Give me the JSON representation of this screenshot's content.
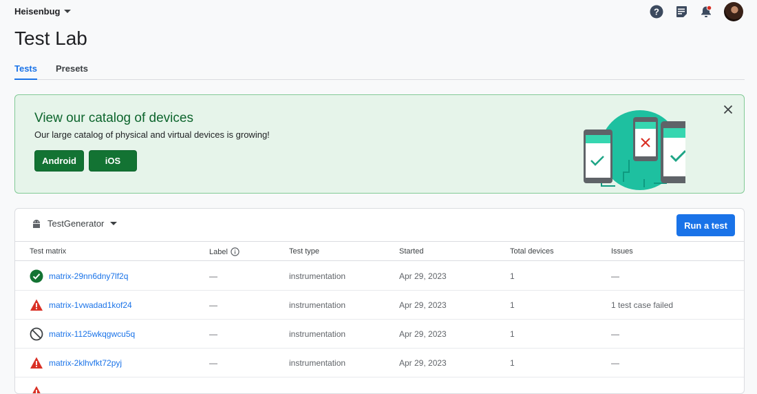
{
  "project": {
    "name": "Heisenbug"
  },
  "header_icons": [
    "help-icon",
    "notes-icon",
    "notifications-icon",
    "avatar"
  ],
  "page": {
    "title": "Test Lab"
  },
  "tabs": [
    {
      "label": "Tests",
      "active": true
    },
    {
      "label": "Presets",
      "active": false
    }
  ],
  "banner": {
    "title": "View our catalog of devices",
    "subtitle": "Our large catalog of physical and virtual devices is growing!",
    "android_label": "Android",
    "ios_label": "iOS"
  },
  "card": {
    "app_name": "TestGenerator",
    "run_label": "Run a test",
    "columns": {
      "matrix": "Test matrix",
      "label": "Label",
      "type": "Test type",
      "started": "Started",
      "devices": "Total devices",
      "issues": "Issues"
    },
    "rows": [
      {
        "status": "passed",
        "matrix": "matrix-29nn6dny7lf2q",
        "label": "—",
        "type": "instrumentation",
        "started": "Apr 29, 2023",
        "devices": "1",
        "issues": "—"
      },
      {
        "status": "failed",
        "matrix": "matrix-1vwadad1kof24",
        "label": "—",
        "type": "instrumentation",
        "started": "Apr 29, 2023",
        "devices": "1",
        "issues": "1 test case failed"
      },
      {
        "status": "cancelled",
        "matrix": "matrix-1125wkqgwcu5q",
        "label": "—",
        "type": "instrumentation",
        "started": "Apr 29, 2023",
        "devices": "1",
        "issues": "—"
      },
      {
        "status": "failed",
        "matrix": "matrix-2klhvfkt72pyj",
        "label": "—",
        "type": "instrumentation",
        "started": "Apr 29, 2023",
        "devices": "1",
        "issues": "—"
      },
      {
        "status": "failed",
        "matrix": "",
        "label": "",
        "type": "",
        "started": "",
        "devices": "",
        "issues": ""
      }
    ]
  },
  "colors": {
    "accent": "#1a73e8",
    "banner_bg": "#e6f4ea",
    "banner_button": "#137333",
    "passed": "#137333",
    "failed": "#d93025",
    "cancelled": "#3c4043"
  }
}
